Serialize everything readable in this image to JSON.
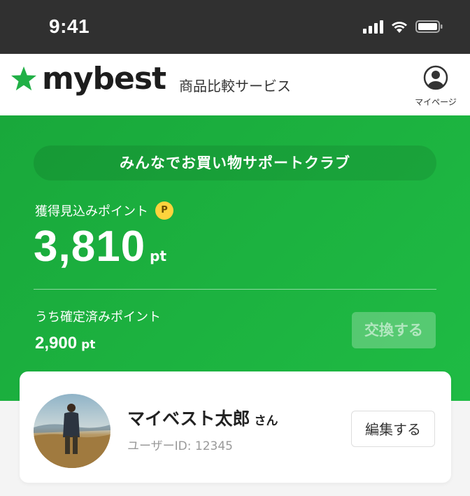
{
  "status_bar": {
    "time": "9:41"
  },
  "header": {
    "logo_text": "mybest",
    "tagline": "商品比較サービス",
    "mypage_label": "マイページ"
  },
  "hero": {
    "club_title": "みんなでお買い物サポートクラブ",
    "estimated_label": "獲得見込みポイント",
    "point_badge": "P",
    "estimated_points": "3,810",
    "estimated_unit": "pt",
    "confirmed_label": "うち確定済みポイント",
    "confirmed_points": "2,900",
    "confirmed_unit": "pt",
    "exchange_button": "交換する"
  },
  "profile": {
    "name": "マイベスト太郎",
    "honorific": "さん",
    "user_id": "ユーザーID: 12345",
    "edit_button": "編集する"
  },
  "colors": {
    "brand_green": "#1fb343",
    "star_green": "#21b046",
    "badge_yellow": "#ffd33d",
    "status_bar": "#303030"
  },
  "icons": [
    "wifi-icon",
    "battery-icon",
    "signal-icon",
    "star-logo-icon",
    "user-circle-icon"
  ]
}
